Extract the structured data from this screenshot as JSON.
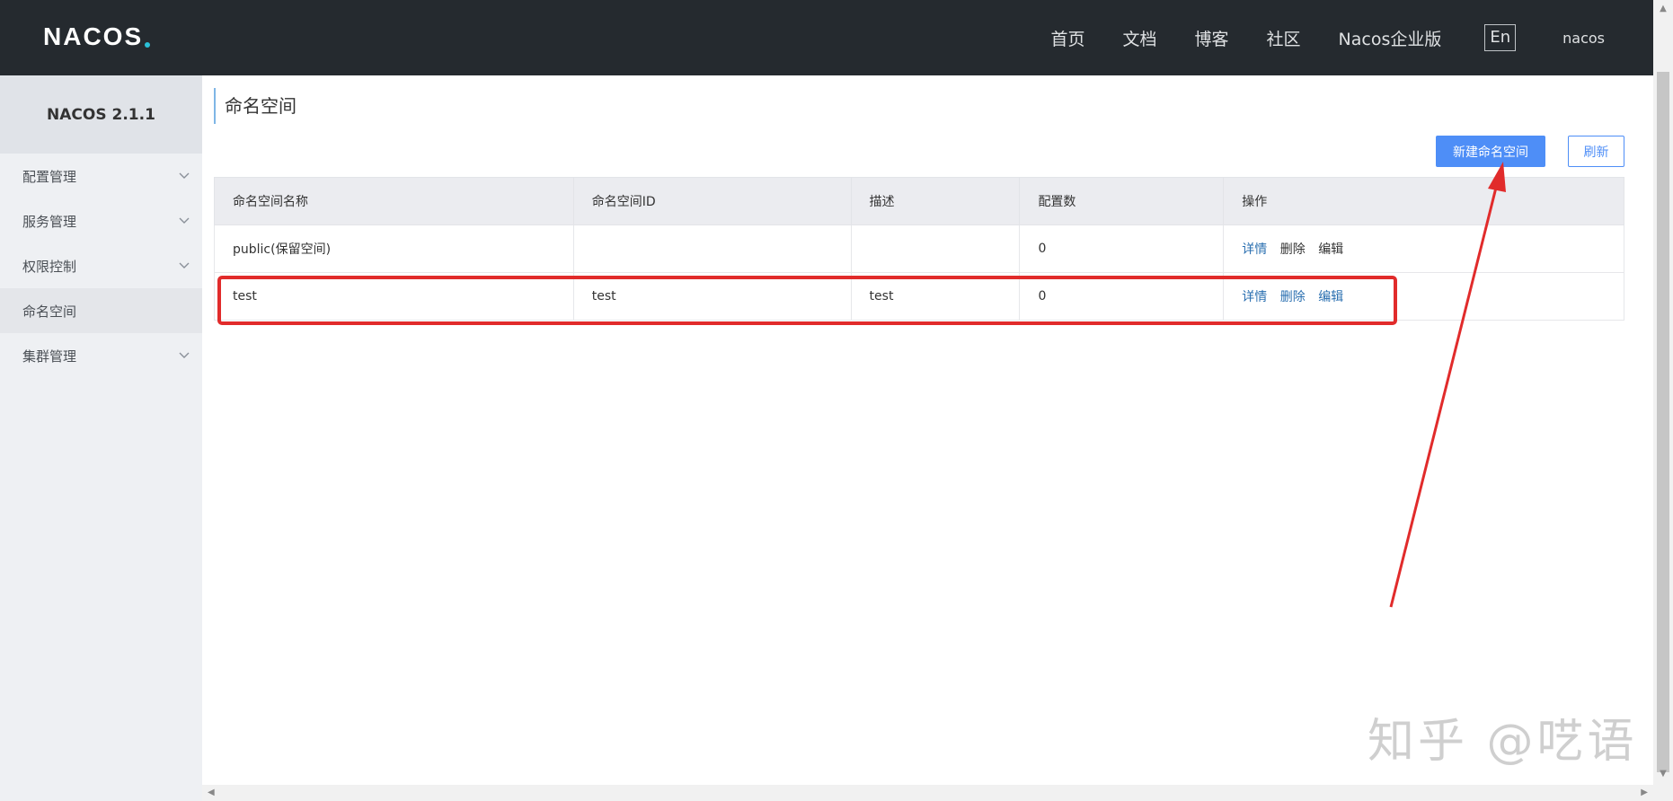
{
  "header": {
    "logo_text": "NACOS",
    "nav": [
      "首页",
      "文档",
      "博客",
      "社区",
      "Nacos企业版"
    ],
    "lang_button": "En",
    "user": "nacos"
  },
  "sidebar": {
    "version": "NACOS 2.1.1",
    "items": [
      {
        "label": "配置管理",
        "expandable": true
      },
      {
        "label": "服务管理",
        "expandable": true
      },
      {
        "label": "权限控制",
        "expandable": true
      },
      {
        "label": "命名空间",
        "expandable": false,
        "active": true
      },
      {
        "label": "集群管理",
        "expandable": true
      }
    ]
  },
  "main": {
    "title": "命名空间",
    "create_button": "新建命名空间",
    "refresh_button": "刷新",
    "table": {
      "columns": [
        "命名空间名称",
        "命名空间ID",
        "描述",
        "配置数",
        "操作"
      ],
      "rows": [
        {
          "name": "public(保留空间)",
          "id": "",
          "desc": "",
          "count": "0",
          "ops": [
            "详情",
            "删除",
            "编辑"
          ]
        },
        {
          "name": "test",
          "id": "test",
          "desc": "test",
          "count": "0",
          "ops": [
            "详情",
            "删除",
            "编辑"
          ]
        }
      ]
    }
  },
  "watermark": "知乎 @呓语",
  "colors": {
    "header_bg": "#252a2f",
    "primary": "#4e8ef7",
    "annotation": "#e12b2b"
  }
}
